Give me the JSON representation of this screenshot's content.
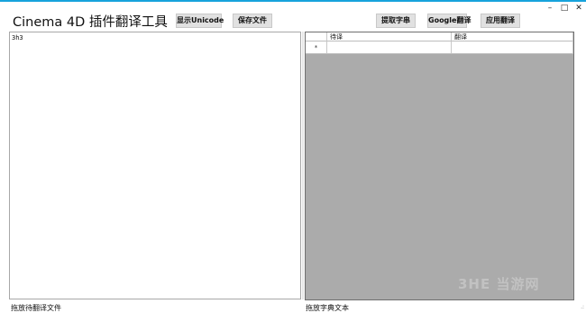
{
  "window": {
    "title": "Cinema 4D 插件翻译工具",
    "min_icon": "minimize-icon",
    "max_icon": "maximize-icon",
    "close_icon": "close-icon",
    "accent": "#17a3dc"
  },
  "toolbar": {
    "show_unicode": "显示Unicode",
    "save_file": "保存文件",
    "extract_strings": "提取字串",
    "google_translate": "Google翻译",
    "apply_translation": "应用翻译"
  },
  "editor": {
    "content": "3h3"
  },
  "grid": {
    "columns": [
      "待译",
      "翻译"
    ],
    "new_row_marker": "*",
    "background": "#ababab"
  },
  "status": {
    "left": "拖放待翻译文件",
    "right": "拖放字典文本"
  },
  "watermark": "3HE 当游网"
}
